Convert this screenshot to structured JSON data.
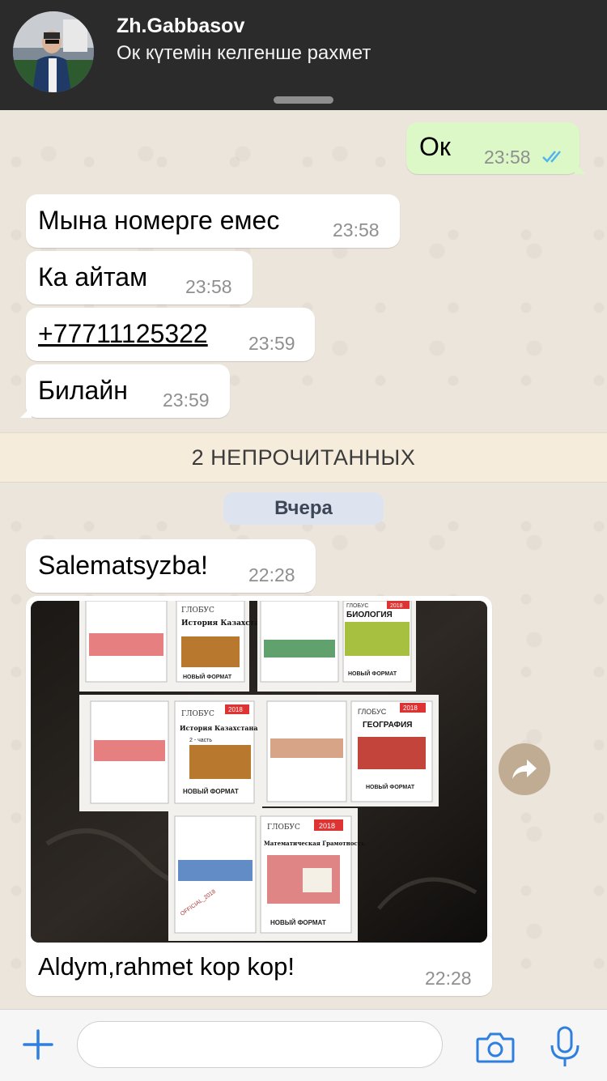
{
  "notification": {
    "sender": "Zh.Gabbasov",
    "preview": "Ок күтемін келгенше рахмет"
  },
  "messages": [
    {
      "direction": "out",
      "text": "Ок",
      "time": "23:58",
      "status": "read"
    },
    {
      "direction": "in",
      "text": "Мына номерге емес",
      "time": "23:58"
    },
    {
      "direction": "in",
      "text": "Ка айтам",
      "time": "23:58"
    },
    {
      "direction": "in",
      "text": "+77711125322",
      "time": "23:59",
      "is_link": true
    },
    {
      "direction": "in",
      "text": "Билайн",
      "time": "23:59"
    }
  ],
  "unread_banner": "2 НЕПРОЧИТАННЫХ",
  "date_separator": "Вчера",
  "later_messages": [
    {
      "direction": "in",
      "text": "Salematsyzba!",
      "time": "22:28"
    },
    {
      "direction": "in",
      "type": "image",
      "caption": "Aldym,rahmet kop kop!",
      "time": "22:28"
    }
  ],
  "photo_labels": {
    "book1_brand": "ГЛОБУС",
    "book1_title": "История Казахстана",
    "book2_brand": "ГЛОБУС",
    "book2_year": "2018",
    "book2_title": "БИОЛОГИЯ",
    "book3_brand": "ГЛОБУС",
    "book3_year": "2018",
    "book3_title": "История Казахстана",
    "book3_part": "2 - часть",
    "book4_brand": "ГЛОБУС",
    "book4_year": "2018",
    "book4_title": "ГЕОГРАФИЯ",
    "book5_brand": "ГЛОБУС",
    "book5_year": "2018",
    "book5_title": "Математическая Грамотность",
    "publisher": "НОВЫЙ ФОРМАТ",
    "watermark": "OFFICIAL_2018"
  },
  "input": {
    "placeholder": ""
  },
  "icons": {
    "read_ticks": "double-check-icon",
    "forward": "forward-icon",
    "add": "plus-icon",
    "camera": "camera-icon",
    "mic": "microphone-icon"
  },
  "colors": {
    "outgoing_bubble": "#dcf8c6",
    "incoming_bubble": "#ffffff",
    "link": "#1f7ad9",
    "read_ticks": "#4fb6ec",
    "accent": "#2f7fe0",
    "banner_bg": "#2b2b2b"
  }
}
